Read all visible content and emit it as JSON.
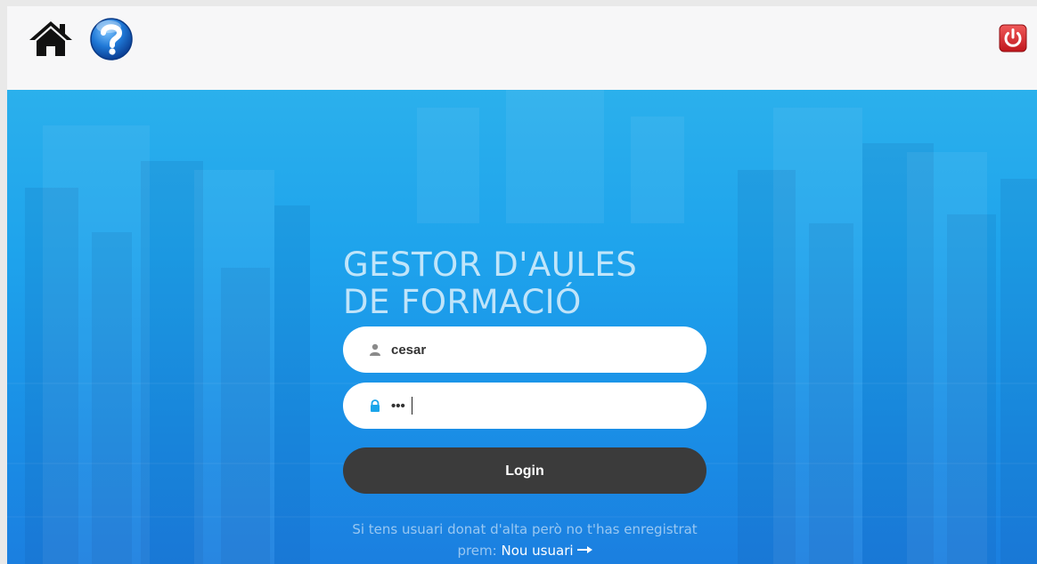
{
  "header": {
    "home_icon": "home-icon",
    "help_icon": "help-icon",
    "power_icon": "power-icon"
  },
  "login": {
    "title_line1": "GESTOR D'AULES",
    "title_line2": "DE FORMACIÓ",
    "username_value": "cesar",
    "password_value": "•••",
    "button_label": "Login",
    "note_text": "Si tens usuari donat d'alta però no t'has enregistrat prem:",
    "new_user_link": "Nou usuari",
    "user_icon": "user-icon",
    "lock_icon": "lock-icon",
    "arrow_icon": "arrow-right-icon"
  },
  "colors": {
    "hero_top": "#2bb0ec",
    "hero_bottom": "#1b7fe0",
    "button": "#3b3b3b",
    "power_red": "#d8262c",
    "lock_blue": "#1aa5ea"
  }
}
